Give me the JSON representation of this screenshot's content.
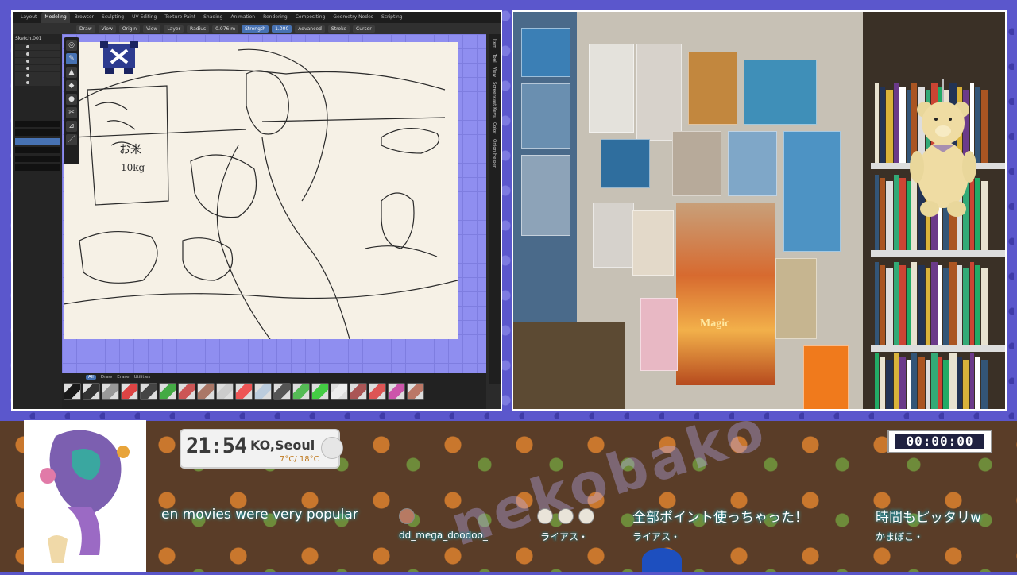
{
  "blender": {
    "workspace_tabs": [
      "Layout",
      "Modeling",
      "Browser",
      "Sculpting",
      "UV Editing",
      "Texture Paint",
      "Shading",
      "Animation",
      "Rendering",
      "Compositing",
      "Geometry Nodes",
      "Scripting"
    ],
    "active_tab_index": 1,
    "toolbar": {
      "draw_mode": "Draw",
      "view": "View",
      "origin": "Origin",
      "view2": "View",
      "layer": "Layer",
      "radius_label": "Radius",
      "radius_value": "0.076 m",
      "strength_label": "Strength",
      "strength_value": "1.000",
      "advanced": "Advanced",
      "stroke": "Stroke",
      "cursor": "Cursor"
    },
    "outliner_title": "Sketch.001",
    "side_tabs": [
      "Item",
      "Tool",
      "View",
      "Screencast Keys",
      "Color",
      "Onion Helper"
    ],
    "screencast_label": "Screencast Keys",
    "brush_tabs": [
      "All",
      "Draw",
      "Erase",
      "Utilities"
    ],
    "brush_colors": [
      "#1a1a1a",
      "#333",
      "#999",
      "#d44",
      "#444",
      "#4a4",
      "#c55",
      "#a76",
      "#ccc",
      "#e55",
      "#bcd",
      "#555",
      "#5b5",
      "#4c4",
      "#eee",
      "#a55",
      "#d55",
      "#c5a",
      "#b76"
    ]
  },
  "clock": {
    "time": "21:54",
    "city": "KO,Seoul",
    "temperature": "7°C/ 18°C"
  },
  "timer": "00:00:00",
  "watermark": "nekobako",
  "chat": [
    {
      "message": "en movies were very popular",
      "user": ""
    },
    {
      "message": "",
      "user": "dd_mega_doodoo_"
    },
    {
      "message": "",
      "user": "ライアス・"
    },
    {
      "message": "全部ポイント使っちゃった！",
      "user": "ライアス・"
    },
    {
      "message": "時間もピッタリw",
      "user": "かまぼこ・"
    }
  ],
  "webcam_poster_text": "Magic"
}
